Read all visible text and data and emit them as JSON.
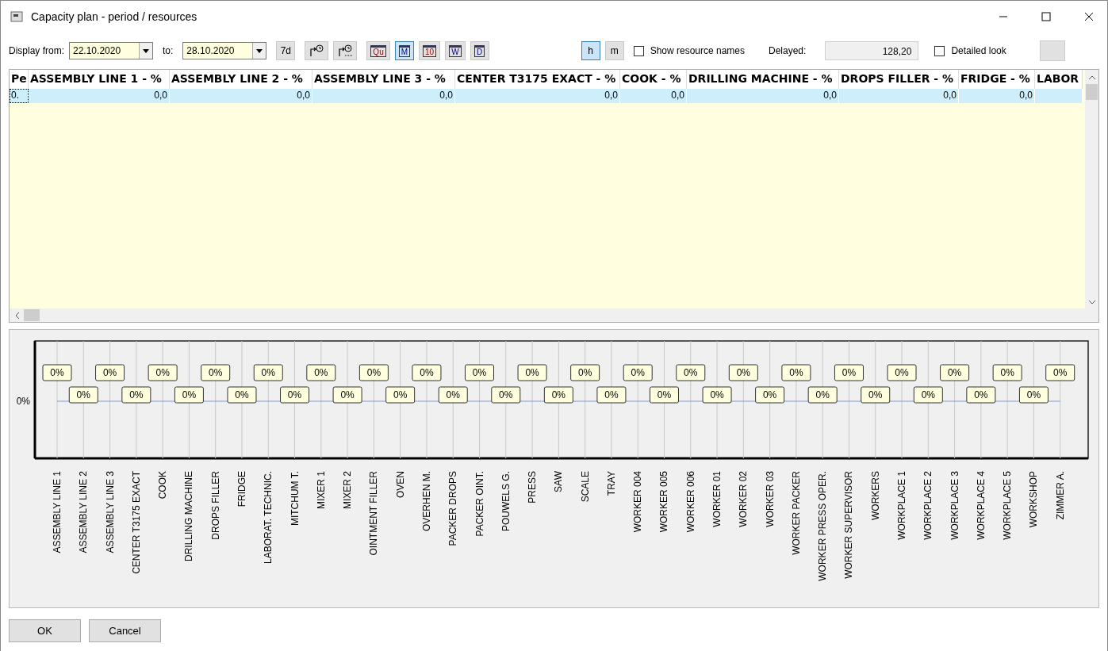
{
  "window": {
    "title": "Capacity plan - period / resources"
  },
  "toolbar": {
    "from_label": "Display from:",
    "from_value": "22.10.2020",
    "to_label": "to:",
    "to_value": "28.10.2020",
    "buttons": [
      {
        "kind": "text",
        "label": "7d",
        "selected": false
      },
      {
        "kind": "icon",
        "selected": false
      },
      {
        "kind": "icon-dotted",
        "selected": false
      },
      {
        "kind": "calendar",
        "label": "Qu",
        "selected": false
      },
      {
        "kind": "calendar",
        "label": "M",
        "selected": true
      },
      {
        "kind": "calendar",
        "label": "10",
        "selected": false
      },
      {
        "kind": "calendar",
        "label": "W",
        "selected": false
      },
      {
        "kind": "calendar",
        "label": "D",
        "selected": false
      }
    ],
    "units": [
      {
        "label": "h",
        "selected": true
      },
      {
        "label": "m",
        "selected": false
      }
    ],
    "show_names": {
      "label": "Show resource names",
      "checked": false
    },
    "delayed_label": "Delayed:",
    "delayed_value": "128,20",
    "detailed": {
      "label": "Detailed look",
      "checked": false
    }
  },
  "table": {
    "columns": [
      "Pe",
      "ASSEMBLY LINE 1 - %",
      "ASSEMBLY LINE 2 - %",
      "ASSEMBLY LINE 3 - %",
      "CENTER T3175 EXACT - %",
      "COOK - %",
      "DRILLING MACHINE - %",
      "DROPS FILLER - %",
      "FRIDGE - %",
      "LABOR"
    ],
    "rows": [
      {
        "selected": true,
        "cells": [
          "0.",
          "0,0",
          "0,0",
          "0,0",
          "0,0",
          "0,0",
          "0,0",
          "0,0",
          "0,0",
          ""
        ]
      }
    ]
  },
  "chart": {
    "kind": "line",
    "categories": [
      "ASSEMBLY LINE 1",
      "ASSEMBLY LINE 2",
      "ASSEMBLY LINE 3",
      "CENTER T3175 EXACT",
      "COOK",
      "DRILLING MACHINE",
      "DROPS FILLER",
      "FRIDGE",
      "LABORAT. TECHNIC.",
      "MITCHUM T.",
      "MIXER 1",
      "MIXER 2",
      "OINTMENT FILLER",
      "OVEN",
      "OVERHEN M.",
      "PACKER DROPS",
      "PACKER OINT.",
      "POUWELS G.",
      "PRESS",
      "SAW",
      "SCALE",
      "TRAY",
      "WORKER 004",
      "WORKER 005",
      "WORKER 006",
      "WORKER 01",
      "WORKER 02",
      "WORKER 03",
      "WORKER PACKER",
      "WORKER PRESS OPER.",
      "WORKER SUPERVISOR",
      "WORKERS",
      "WORKPLACE 1",
      "WORKPLACE 2",
      "WORKPLACE 3",
      "WORKPLACE 4",
      "WORKPLACE 5",
      "WORKSHOP",
      "ZIMMER A."
    ],
    "value_labels": [
      "0%",
      "0%",
      "0%",
      "0%",
      "0%",
      "0%",
      "0%",
      "0%",
      "0%",
      "0%",
      "0%",
      "0%",
      "0%",
      "0%",
      "0%",
      "0%",
      "0%",
      "0%",
      "0%",
      "0%",
      "0%",
      "0%",
      "0%",
      "0%",
      "0%",
      "0%",
      "0%",
      "0%",
      "0%",
      "0%",
      "0%",
      "0%",
      "0%",
      "0%",
      "0%",
      "0%",
      "0%",
      "0%",
      "0%"
    ],
    "y_axis_label": "0%"
  },
  "buttons": [
    {
      "label": "OK"
    },
    {
      "label": "Cancel"
    }
  ]
}
